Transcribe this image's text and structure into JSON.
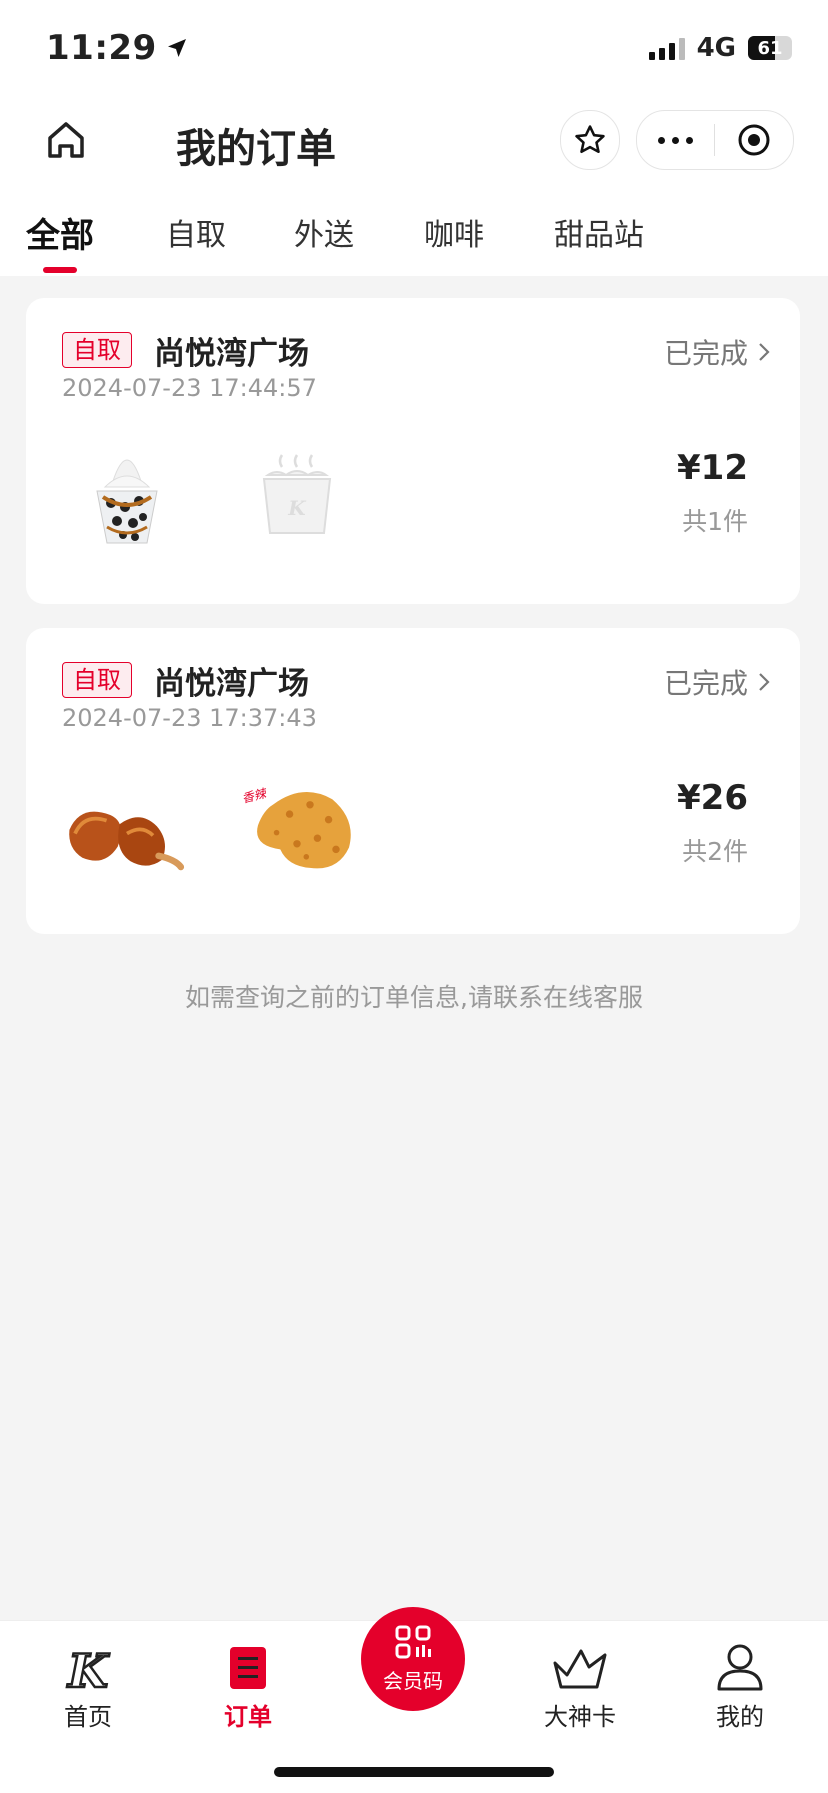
{
  "status_bar": {
    "time": "11:29",
    "network": "4G",
    "battery": "61"
  },
  "header": {
    "title": "我的订单"
  },
  "tabs": [
    {
      "label": "全部",
      "active": true
    },
    {
      "label": "自取"
    },
    {
      "label": "外送"
    },
    {
      "label": "咖啡"
    },
    {
      "label": "甜品站"
    }
  ],
  "orders": [
    {
      "type_badge": "自取",
      "store": "尚悦湾广场",
      "status": "已完成",
      "time": "2024-07-23 17:44:57",
      "price": "¥12",
      "count": "共1件",
      "items": [
        "sundae-image",
        "placeholder-bucket-image"
      ]
    },
    {
      "type_badge": "自取",
      "store": "尚悦湾广场",
      "status": "已完成",
      "time": "2024-07-23 17:37:43",
      "price": "¥26",
      "count": "共2件",
      "items": [
        "roast-wings-image",
        "fried-chicken-image"
      ]
    }
  ],
  "footer_note": "如需查询之前的订单信息,请联系在线客服",
  "tabbar": [
    {
      "label": "首页",
      "icon": "kfc-k-icon"
    },
    {
      "label": "订单",
      "icon": "order-list-icon",
      "active": true
    },
    {
      "label": "会员码",
      "icon": "qr-code-icon"
    },
    {
      "label": "大神卡",
      "icon": "crown-icon"
    },
    {
      "label": "我的",
      "icon": "user-icon"
    }
  ],
  "colors": {
    "accent": "#e4002b",
    "background": "#f4f4f4"
  }
}
